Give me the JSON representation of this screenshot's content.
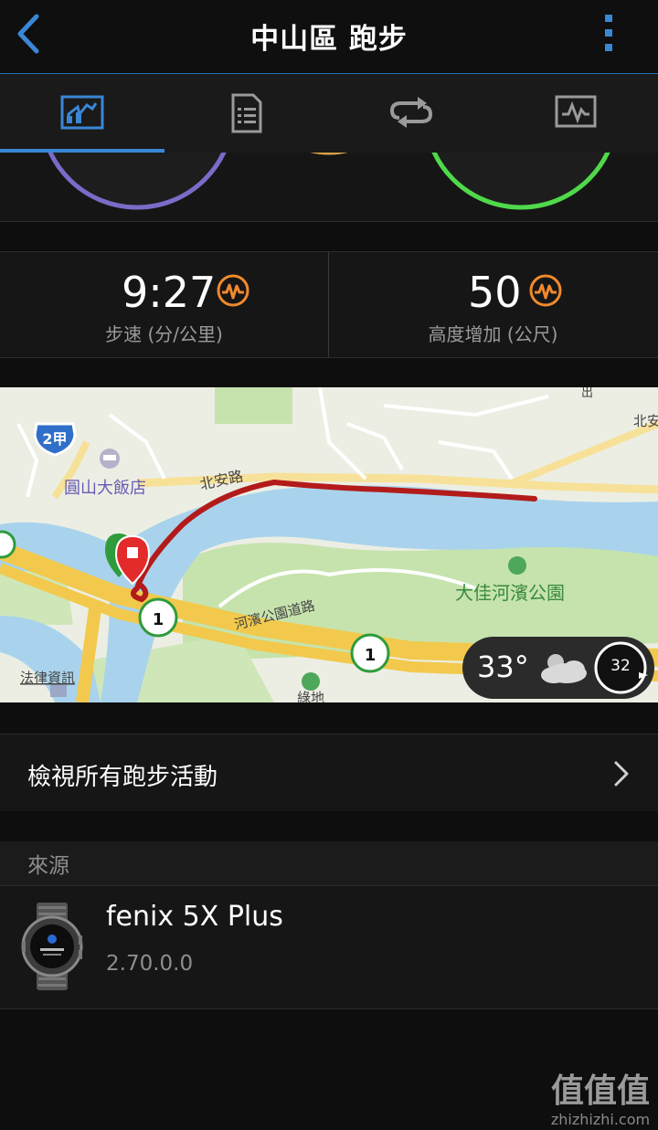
{
  "header": {
    "title": "中山區 跑步",
    "back_icon": "chevron-left-icon",
    "menu_icon": "more-vertical-icon"
  },
  "tabs": [
    {
      "icon": "map-overview-icon",
      "active": true
    },
    {
      "icon": "details-document-icon",
      "active": false
    },
    {
      "icon": "laps-repeat-icon",
      "active": false
    },
    {
      "icon": "chart-monitor-icon",
      "active": false
    }
  ],
  "stats": [
    {
      "value": "9:27",
      "label": "步速 (分/公里)",
      "icon": "heart-zone-icon"
    },
    {
      "value": "50",
      "label": "高度增加 (公尺)",
      "icon": "heart-zone-icon"
    }
  ],
  "map": {
    "labels": {
      "road_north_anan": "北安路",
      "hotel": "圓山大飯店",
      "park": "大佳河濱公園",
      "park_road": "河濱公園道路",
      "law": "法律資訊",
      "route_shield": "2甲",
      "top_right_road": "北安",
      "bottom_label": "綠地",
      "top_right_char": "出"
    },
    "highway_markers": [
      "1",
      "1"
    ],
    "weather": {
      "temperature": "33°",
      "wind_speed": "32",
      "icon": "cloud-sun-icon"
    }
  },
  "view_all": {
    "label": "檢視所有跑步活動"
  },
  "source": {
    "header": "來源",
    "device_name": "fenix 5X Plus",
    "version": "2.70.0.0"
  },
  "watermark": {
    "text": "值值值",
    "site": "zhizhizhi.com"
  },
  "colors": {
    "accent": "#3a87d6",
    "zone_orange": "#f08a2c",
    "track_red": "#b31b1b",
    "river": "#a9d3ec"
  }
}
